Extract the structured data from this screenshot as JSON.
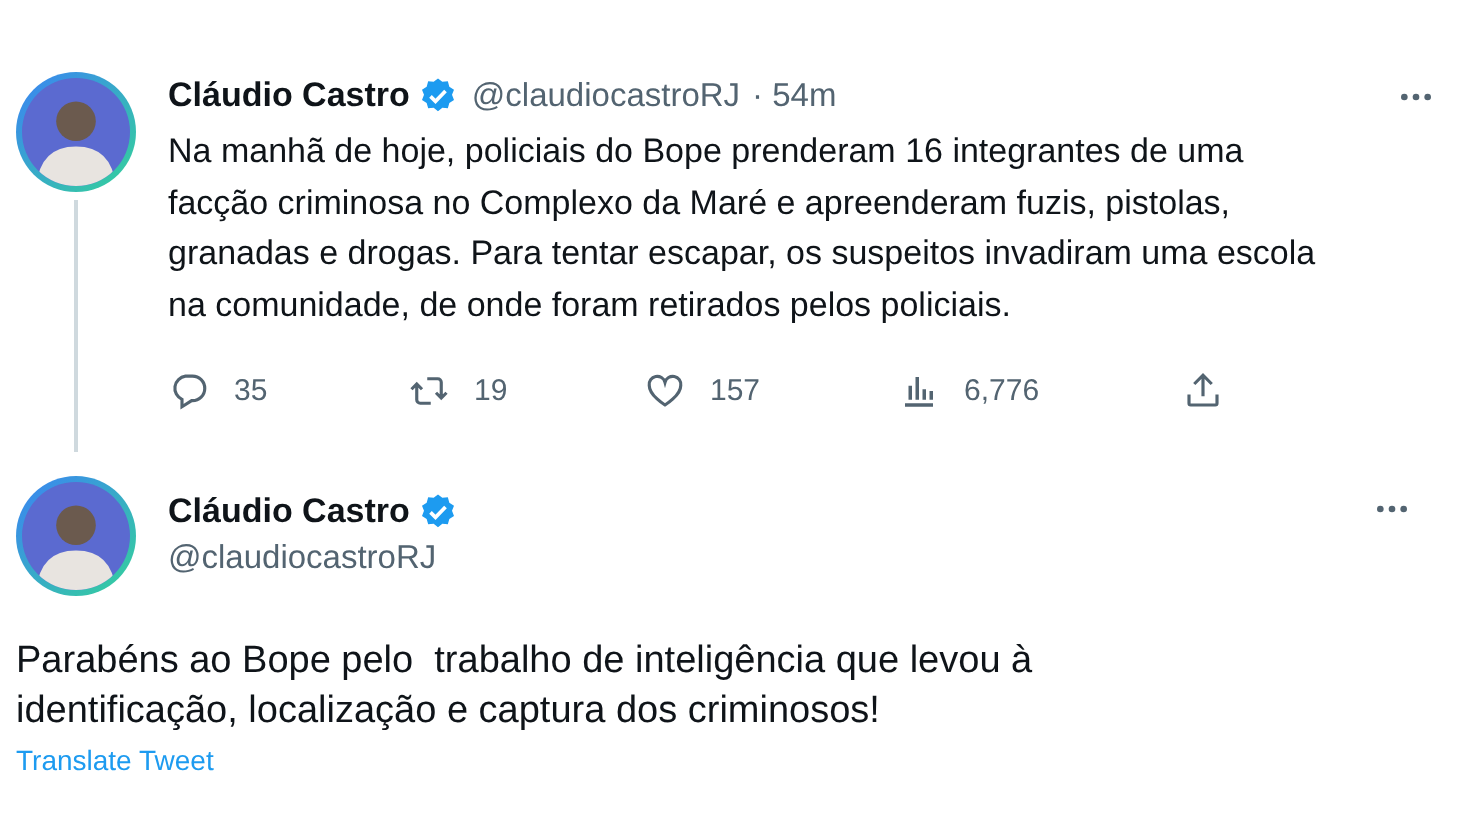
{
  "tweets": [
    {
      "name": "Cláudio Castro",
      "verified": true,
      "handle": "@claudiocastroRJ",
      "time": "· 54m",
      "kind": "thread",
      "text": "Na manhã de hoje, policiais do Bope prenderam 16 integrantes de uma facção criminosa no Complexo da Maré e apreenderam fuzis, pistolas, granadas e drogas. Para tentar escapar, os suspeitos invadiram uma escola na comunidade, de onde foram retirados pelos policiais.",
      "actions": [
        {
          "kind": "reply",
          "count": "35"
        },
        {
          "kind": "retweet",
          "count": "19"
        },
        {
          "kind": "like",
          "count": "157"
        },
        {
          "kind": "views",
          "count": "6,776"
        },
        {
          "kind": "share"
        }
      ]
    },
    {
      "name": "Cláudio Castro",
      "verified": true,
      "handle": "@claudiocastroRJ",
      "kind": "main",
      "text": "Parabéns ao Bope pelo  trabalho de inteligência que levou à identificação, localização e captura dos criminosos!",
      "translate": "Translate Tweet"
    }
  ]
}
